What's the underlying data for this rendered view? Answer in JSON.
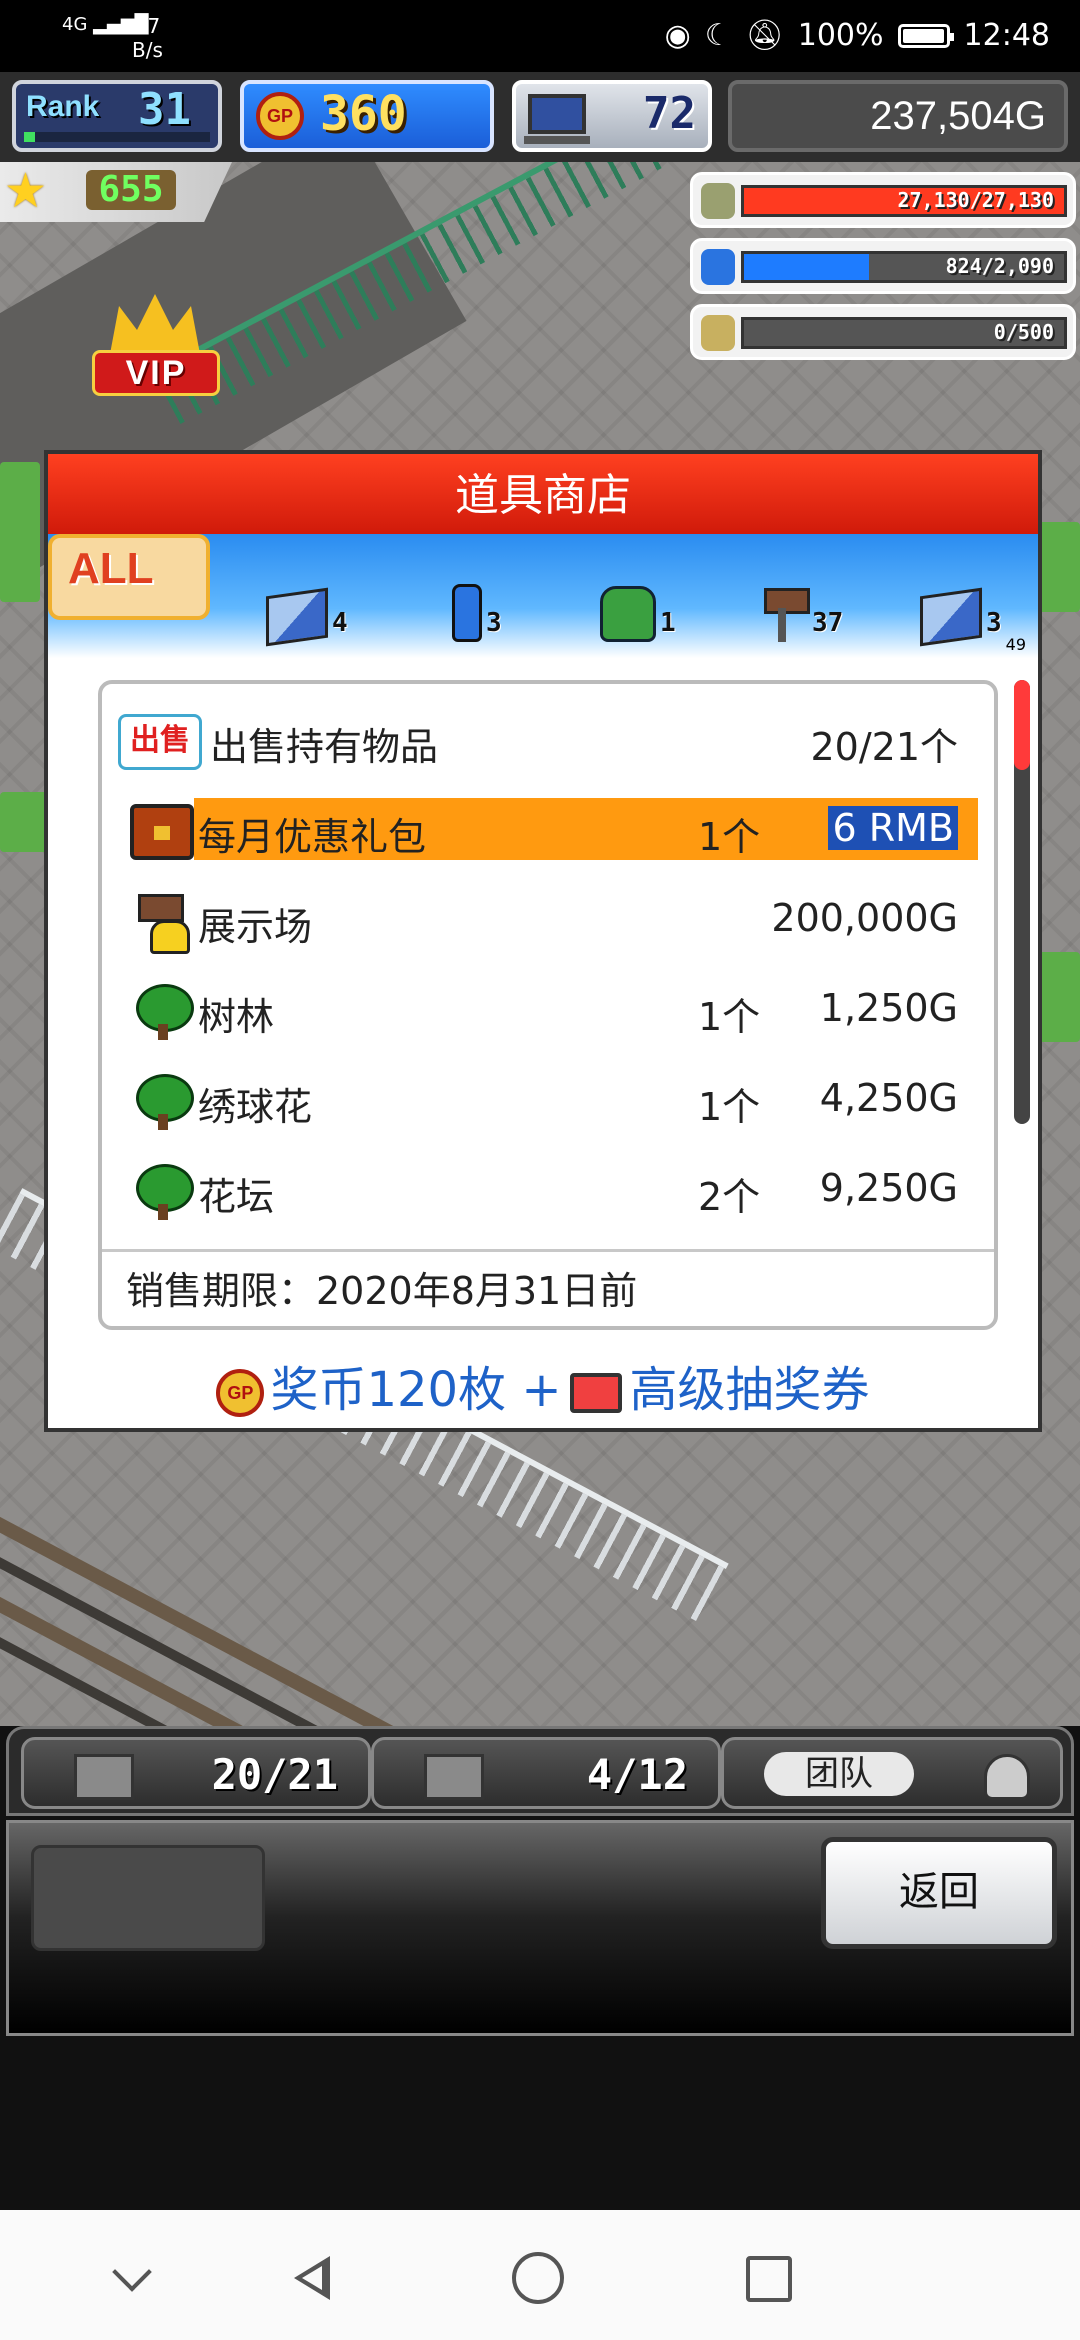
{
  "status_bar": {
    "network": "4G",
    "speed_value": "97",
    "speed_unit": "B/s",
    "battery": "100%",
    "time": "12:48"
  },
  "hud": {
    "rank_label": "Rank",
    "rank_value": "31",
    "gp_icon": "GP",
    "gp_value": "360",
    "pc_value": "72",
    "money": "237,504G",
    "star_value": "655"
  },
  "resources": [
    {
      "icon": "coin-stack-icon",
      "text": "27,130/27,130",
      "fill": 1.0,
      "color": "#ff3a20"
    },
    {
      "icon": "water-bottle-icon",
      "text": "824/2,090",
      "fill": 0.39,
      "color": "#1e7cff"
    },
    {
      "icon": "wheat-icon",
      "text": "0/500",
      "fill": 0.0,
      "color": "#f0c030"
    }
  ],
  "vip_label": "VIP",
  "shop": {
    "title": "道具商店",
    "tabs": [
      {
        "label": "ALL",
        "count": "49",
        "icon": "all-tab"
      },
      {
        "label": "",
        "count": "4",
        "icon": "blue-cube-icon"
      },
      {
        "label": "",
        "count": "3",
        "icon": "bottle-icon"
      },
      {
        "label": "",
        "count": "1",
        "icon": "green-bag-icon"
      },
      {
        "label": "",
        "count": "37",
        "icon": "signpost-icon"
      },
      {
        "label": "",
        "count": "3",
        "icon": "blue-cube-icon"
      }
    ],
    "sell_row": {
      "icon_text": "出售",
      "label": "出售持有物品",
      "count": "20/21个"
    },
    "items": [
      {
        "icon": "treasure-chest-icon",
        "name": "每月优惠礼包",
        "qty": "1个",
        "price": "6 RMB",
        "highlighted": true
      },
      {
        "icon": "bell-sign-icon",
        "name": "展示场",
        "qty": "",
        "price": "200,000G",
        "highlighted": false
      },
      {
        "icon": "tree-icon",
        "name": "树林",
        "qty": "1个",
        "price": "1,250G",
        "highlighted": false
      },
      {
        "icon": "tree-icon",
        "name": "绣球花",
        "qty": "1个",
        "price": "4,250G",
        "highlighted": false
      },
      {
        "icon": "tree-icon",
        "name": "花坛",
        "qty": "2个",
        "price": "9,250G",
        "highlighted": false
      }
    ],
    "deadline": "销售期限：2020年8月31日前",
    "reward_part1": "奖币120枚 +",
    "reward_part2": "高级抽奖券"
  },
  "bottom_tabs": [
    {
      "icon": "storage-box-icon",
      "value": "20/21"
    },
    {
      "icon": "garage-icon",
      "value": "4/12"
    },
    {
      "label": "团队"
    }
  ],
  "back_button": "返回"
}
